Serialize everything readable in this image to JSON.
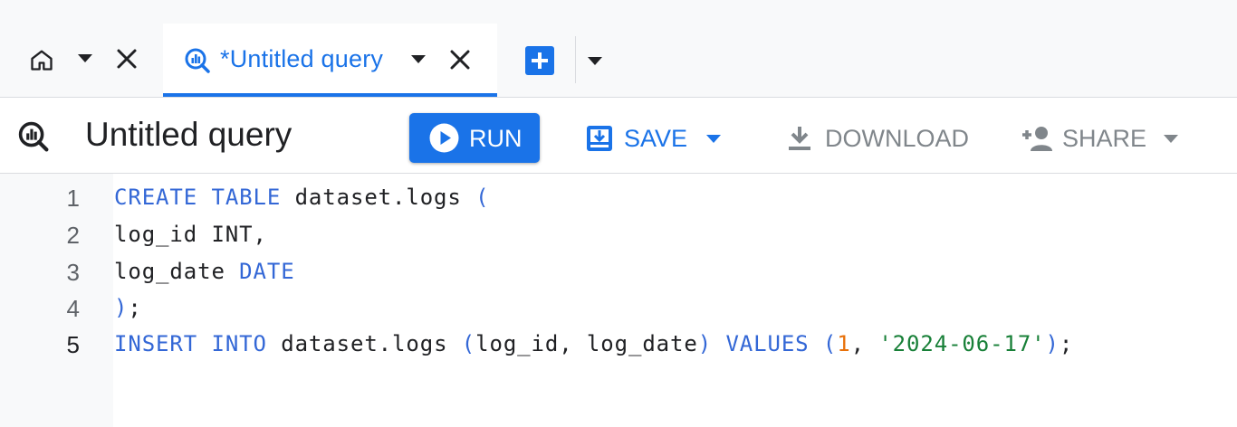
{
  "tabs": {
    "home": {
      "icon": "home-icon"
    },
    "query_tab": {
      "label": "*Untitled query",
      "icon": "query-icon",
      "active": true
    },
    "add_tab_icon": "add-box-icon"
  },
  "toolbar": {
    "title": "Untitled query",
    "run_label": "RUN",
    "save_label": "SAVE",
    "download_label": "DOWNLOAD",
    "share_label": "SHARE"
  },
  "editor": {
    "active_line": 5,
    "lines": [
      {
        "number": "1",
        "tokens": [
          {
            "t": "CREATE",
            "c": "kw"
          },
          {
            "t": " "
          },
          {
            "t": "TABLE",
            "c": "kw"
          },
          {
            "t": " dataset.logs "
          },
          {
            "t": "(",
            "c": "pn"
          }
        ]
      },
      {
        "number": "2",
        "tokens": [
          {
            "t": "log_id INT,"
          }
        ]
      },
      {
        "number": "3",
        "tokens": [
          {
            "t": "log_date "
          },
          {
            "t": "DATE",
            "c": "kw"
          }
        ]
      },
      {
        "number": "4",
        "tokens": [
          {
            "t": ")",
            "c": "pn"
          },
          {
            "t": ";"
          }
        ]
      },
      {
        "number": "5",
        "tokens": [
          {
            "t": "INSERT",
            "c": "kw"
          },
          {
            "t": " "
          },
          {
            "t": "INTO",
            "c": "kw"
          },
          {
            "t": " dataset.logs "
          },
          {
            "t": "(",
            "c": "pn"
          },
          {
            "t": "log_id, log_date"
          },
          {
            "t": ")",
            "c": "pn"
          },
          {
            "t": " "
          },
          {
            "t": "VALUES",
            "c": "kw"
          },
          {
            "t": " "
          },
          {
            "t": "(",
            "c": "pn"
          },
          {
            "t": "1",
            "c": "num"
          },
          {
            "t": ", "
          },
          {
            "t": "'2024-06-17'",
            "c": "str"
          },
          {
            "t": ")",
            "c": "pn"
          },
          {
            "t": ";"
          }
        ]
      }
    ]
  },
  "colors": {
    "accent": "#1a73e8",
    "keyword": "#3367d6",
    "number": "#e8710a",
    "string": "#188038",
    "disabled": "#80868b"
  }
}
